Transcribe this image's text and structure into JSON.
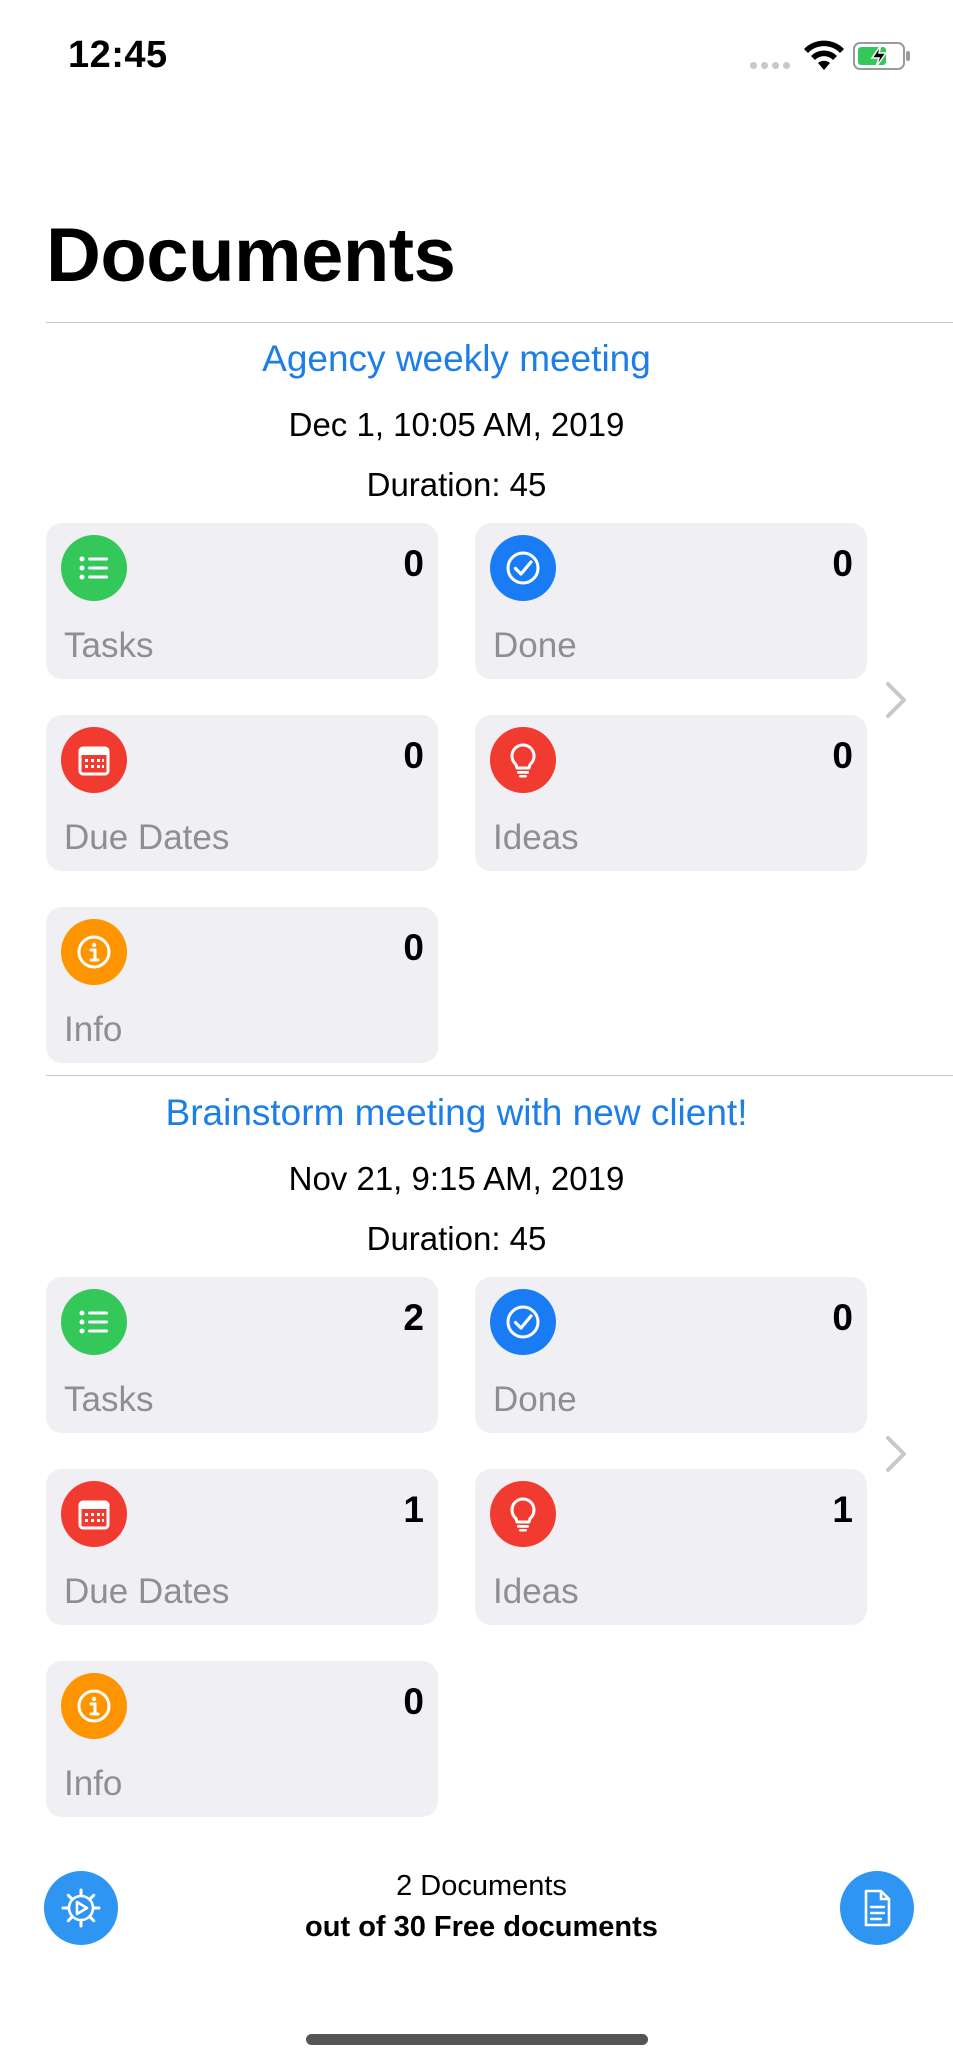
{
  "status_bar": {
    "time": "12:45"
  },
  "page_title": "Documents",
  "documents": [
    {
      "title": "Agency weekly meeting",
      "date": "Dec 1, 10:05 AM, 2019",
      "duration": "Duration: 45",
      "cards": {
        "tasks": {
          "label": "Tasks",
          "count": "0"
        },
        "done": {
          "label": "Done",
          "count": "0"
        },
        "due_dates": {
          "label": "Due Dates",
          "count": "0"
        },
        "ideas": {
          "label": "Ideas",
          "count": "0"
        },
        "info": {
          "label": "Info",
          "count": "0"
        }
      }
    },
    {
      "title": "Brainstorm meeting with new client!",
      "date": "Nov 21, 9:15 AM, 2019",
      "duration": "Duration: 45",
      "cards": {
        "tasks": {
          "label": "Tasks",
          "count": "2"
        },
        "done": {
          "label": "Done",
          "count": "0"
        },
        "due_dates": {
          "label": "Due Dates",
          "count": "1"
        },
        "ideas": {
          "label": "Ideas",
          "count": "1"
        },
        "info": {
          "label": "Info",
          "count": "0"
        }
      }
    }
  ],
  "footer": {
    "count_text": "2 Documents",
    "limit_text": "out of 30 Free documents",
    "left_button_icon": "settings-gear-icon",
    "right_button_icon": "new-document-icon"
  },
  "colors": {
    "accent": "#1c7ee6",
    "tasks": "#34c759",
    "done": "#1a7cf5",
    "due_dates": "#f23b30",
    "ideas": "#f23b30",
    "info": "#fe9500",
    "card_bg": "#efeff4"
  }
}
